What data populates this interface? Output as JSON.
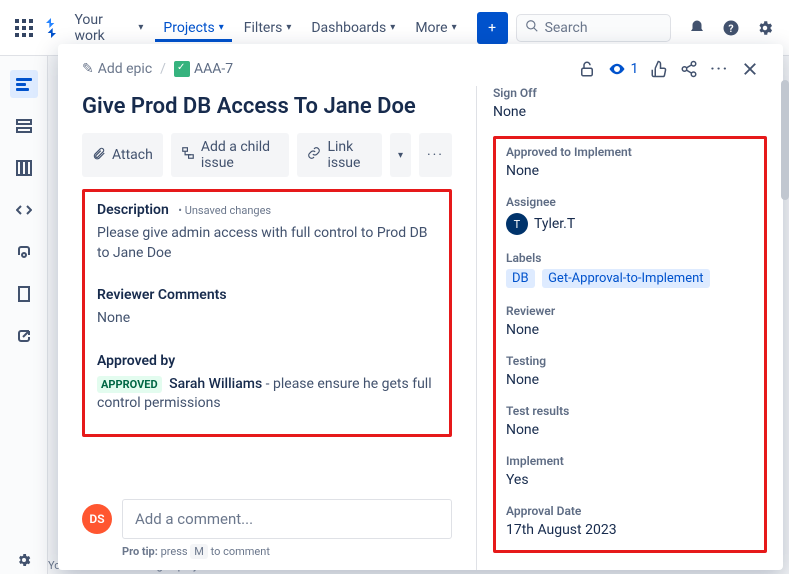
{
  "topnav": {
    "your_work": "Your work",
    "projects": "Projects",
    "filters": "Filters",
    "dashboards": "Dashboards",
    "more": "More",
    "search_placeholder": "Search"
  },
  "footer_note": "You're in a team-managed project",
  "breadcrumb": {
    "add_epic": "Add epic",
    "slash": "/",
    "issue_key": "AAA-7"
  },
  "header": {
    "watch_count": "1"
  },
  "title": "Give Prod DB Access To Jane Doe",
  "actions": {
    "attach": "Attach",
    "child": "Add a child issue",
    "link": "Link issue"
  },
  "main": {
    "description_label": "Description",
    "unsaved": "• Unsaved changes",
    "description_text": "Please give admin access with full control to Prod DB to  Jane Doe",
    "reviewer_comments_label": "Reviewer Comments",
    "reviewer_comments_value": "None",
    "approved_by_label": "Approved by",
    "approved_tag": "APPROVED",
    "approver_name": "Sarah Williams",
    "approver_note": " - please ensure he gets full control permissions"
  },
  "comment": {
    "avatar": "DS",
    "placeholder": "Add a comment...",
    "tip_prefix": "Pro tip: ",
    "tip_mid": "press ",
    "tip_key": "M",
    "tip_suffix": " to comment"
  },
  "side": {
    "signoff_label": "Sign Off",
    "signoff_value": "None",
    "approved_impl_label": "Approved to Implement",
    "approved_impl_value": "None",
    "assignee_label": "Assignee",
    "assignee_initial": "T",
    "assignee_name": "Tyler.T",
    "labels_label": "Labels",
    "label1": "DB",
    "label2": "Get-Approval-to-Implement",
    "reviewer_label": "Reviewer",
    "reviewer_value": "None",
    "testing_label": "Testing",
    "testing_value": "None",
    "testres_label": "Test results",
    "testres_value": "None",
    "implement_label": "Implement",
    "implement_value": "Yes",
    "appdate_label": "Approval Date",
    "appdate_value": "17th August 2023"
  }
}
